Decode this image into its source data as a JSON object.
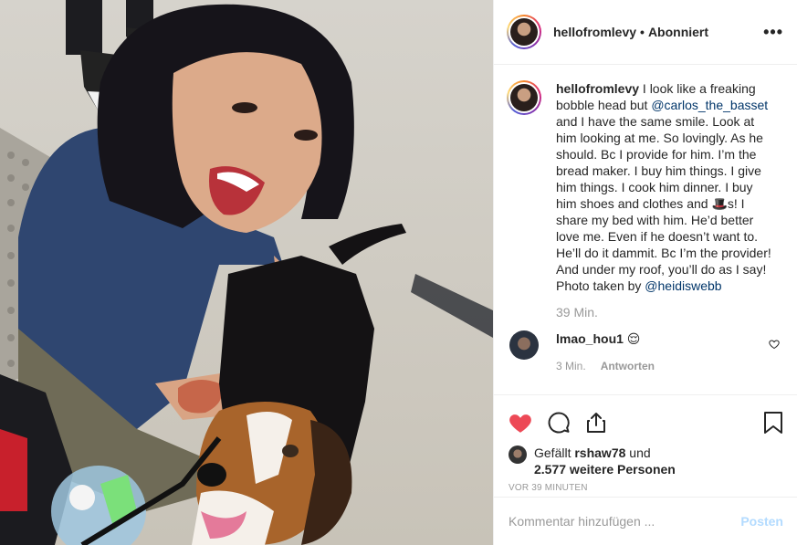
{
  "header": {
    "username": "hellofromlevy",
    "separator": "•",
    "follow_status": "Abonniert",
    "more_label": "•••"
  },
  "caption": {
    "username": "hellofromlevy",
    "text_1": "I look like a freaking bobble head but ",
    "mention_1": "@carlos_the_basset",
    "text_2": " and I have the same smile. Look at him looking at me. So lovingly. As he should. Bc I provide for him. I’m the bread maker. I buy him things. I give him things. I cook him dinner. I buy him shoes and clothes and ",
    "emoji": "🎩",
    "text_3": "s! I share my bed with him. He’d better love me. Even if he doesn’t want to. He’ll do it dammit. Bc I’m the provider! And under my roof, you’ll do as I say! Photo taken by ",
    "mention_2": "@heidiswebb",
    "time": "39 Min."
  },
  "comment": {
    "username": "lmao_hou1",
    "text": "😌",
    "time": "3 Min.",
    "reply_label": "Antworten"
  },
  "likes": {
    "prefix": "Gefällt ",
    "user": "rshaw78",
    "middle": " und",
    "count": "2.577 weitere Personen"
  },
  "age": "VOR 39 MINUTEN",
  "add_comment": {
    "placeholder": "Kommentar hinzufügen ...",
    "post_label": "Posten"
  },
  "icons": {
    "more": "more-horizontal-icon",
    "like": "heart-filled-icon",
    "comment": "comment-icon",
    "share": "share-icon",
    "save": "bookmark-icon",
    "comment_like": "heart-outline-icon"
  },
  "colors": {
    "like_red": "#ed4956",
    "link": "#003569",
    "muted": "#999999",
    "post_button": "#b3dbff"
  }
}
